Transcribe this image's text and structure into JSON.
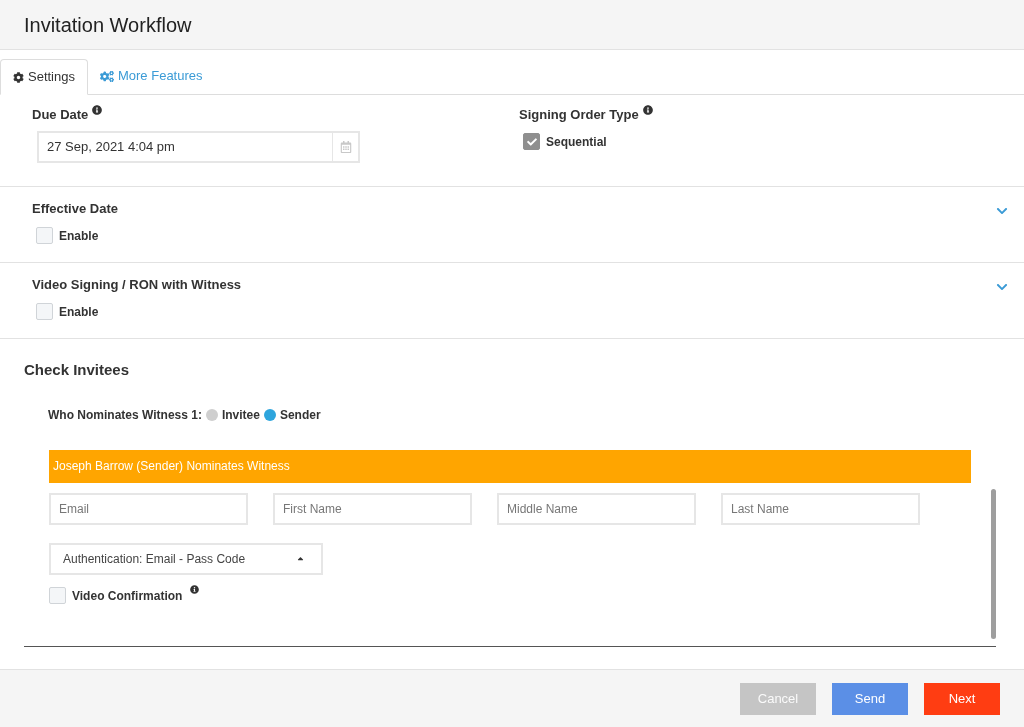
{
  "header": {
    "title": "Invitation Workflow"
  },
  "tabs": [
    {
      "label": "Settings",
      "selected": true,
      "kind": "gear"
    },
    {
      "label": "More Features",
      "selected": false,
      "kind": "gears"
    }
  ],
  "due_date": {
    "label": "Due Date",
    "value": "27 Sep, 2021 4:04 pm"
  },
  "signing_order": {
    "label": "Signing Order Type",
    "option": {
      "label": "Sequential",
      "checked": true
    }
  },
  "sections": [
    {
      "title": "Effective Date",
      "expanded": false,
      "option": {
        "label": "Enable",
        "checked": false
      }
    },
    {
      "title": "Video Signing / RON with Witness",
      "expanded": false,
      "option": {
        "label": "Enable",
        "checked": false
      }
    }
  ],
  "check_invitees": {
    "title": "Check Invitees",
    "nominates_label": "Who Nominates Witness 1:",
    "nominators": [
      {
        "label": "Invitee",
        "selected": false
      },
      {
        "label": "Sender",
        "selected": true
      }
    ],
    "banner": "Joseph Barrow (Sender) Nominates Witness",
    "fields": [
      {
        "placeholder": "Email"
      },
      {
        "placeholder": "First Name"
      },
      {
        "placeholder": "Middle Name"
      },
      {
        "placeholder": "Last Name"
      }
    ],
    "authentication": "Authentication: Email - Pass Code",
    "video_confirmation": {
      "label": "Video Confirmation",
      "checked": false
    }
  },
  "buttons": [
    {
      "label": "Cancel",
      "kind": "cancel",
      "disabled": true
    },
    {
      "label": "Send",
      "kind": "send",
      "disabled": false
    },
    {
      "label": "Next",
      "kind": "next",
      "disabled": false
    }
  ]
}
